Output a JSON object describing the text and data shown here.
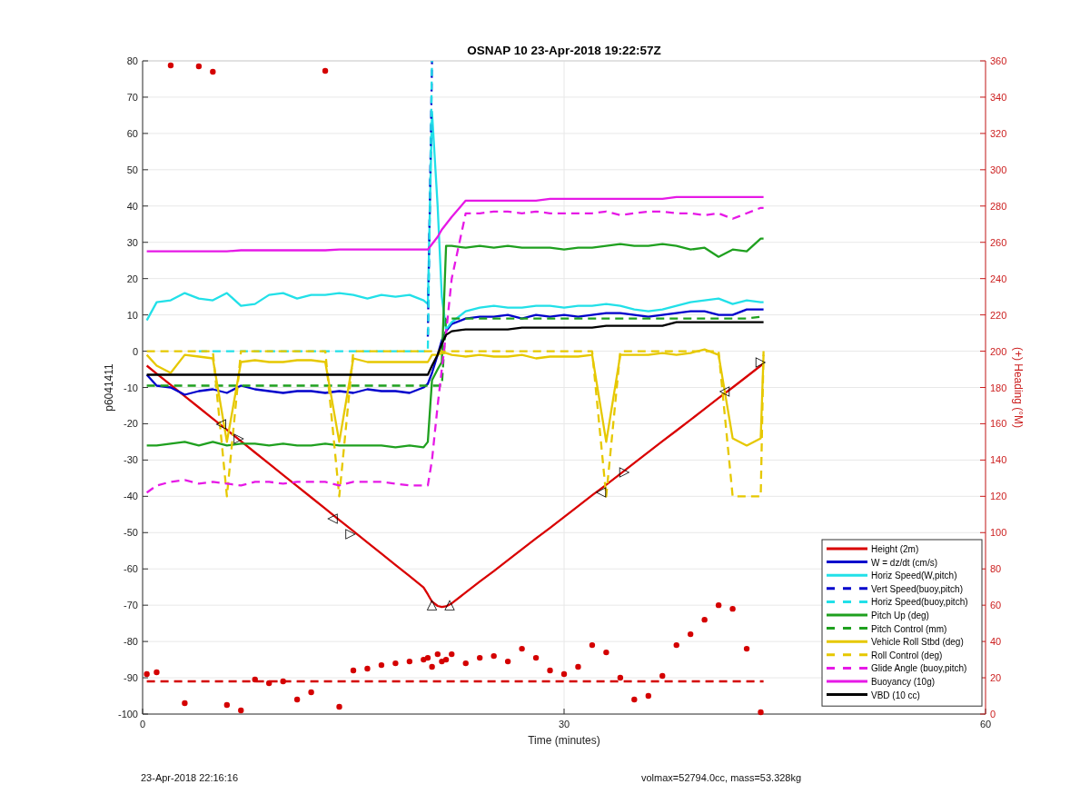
{
  "figure": {
    "chart_data": {
      "type": "line",
      "title": "OSNAP 10 23-Apr-2018 19:22:57Z",
      "xlabel": "Time (minutes)",
      "ylabel": "p6041411",
      "y2label": "(+) Heading (°M)",
      "xlim": [
        0,
        60
      ],
      "ylim": [
        -100,
        80
      ],
      "y2lim": [
        0,
        360
      ],
      "xticks": [
        0,
        30,
        60
      ],
      "yticks": [
        -100,
        -90,
        -80,
        -70,
        -60,
        -50,
        -40,
        -30,
        -20,
        -10,
        0,
        10,
        20,
        30,
        40,
        50,
        60,
        70,
        80
      ],
      "y2ticks": [
        0,
        20,
        40,
        60,
        80,
        100,
        120,
        140,
        160,
        180,
        200,
        220,
        240,
        260,
        280,
        300,
        320,
        340,
        360
      ],
      "grid": true,
      "legend": true,
      "x": [
        0.3,
        1,
        2,
        3,
        4,
        5,
        6,
        7,
        8,
        9,
        10,
        11,
        12,
        13,
        14,
        15,
        16,
        17,
        18,
        19,
        20,
        20.3,
        20.6,
        21,
        21.3,
        21.6,
        22,
        23,
        24,
        25,
        26,
        27,
        28,
        29,
        30,
        31,
        32,
        33,
        34,
        35,
        36,
        37,
        38,
        39,
        40,
        41,
        42,
        43,
        44,
        44.2
      ],
      "series": [
        {
          "name": "Height (2m)",
          "color": "#d90000",
          "line_style": "solid",
          "values": [
            -4,
            -6.2,
            -9.3,
            -12.4,
            -15.5,
            -18.6,
            -21.7,
            -24.8,
            -27.9,
            -31,
            -34.1,
            -37.2,
            -40.3,
            -43.4,
            -46.5,
            -49.6,
            -52.7,
            -55.8,
            -58.9,
            -62,
            -65.1,
            -67,
            -69,
            -70.2,
            -70.5,
            -70.3,
            -69.5,
            -66.5,
            -63.5,
            -60.6,
            -57.6,
            -54.6,
            -51.6,
            -48.7,
            -45.7,
            -42.7,
            -39.7,
            -36.8,
            -33.8,
            -30.8,
            -27.8,
            -24.8,
            -21.9,
            -18.9,
            -15.9,
            -12.9,
            -10,
            -7,
            -4,
            -3.4
          ]
        },
        {
          "name": "W = dz/dt (cm/s)",
          "color": "#0000cc",
          "line_style": "solid",
          "values": [
            -6.5,
            -9.5,
            -10,
            -12,
            -11,
            -10.5,
            -11.5,
            -9.5,
            -10.5,
            -11,
            -11.5,
            -11,
            -11,
            -11.5,
            -11,
            -11.5,
            -10.5,
            -11,
            -11,
            -11.5,
            -10,
            -9,
            -6,
            -1,
            3,
            5.5,
            7.5,
            9,
            9.5,
            9.5,
            10,
            9,
            10,
            9.5,
            10,
            9.5,
            10,
            10.5,
            10.5,
            10,
            9.5,
            10,
            10.5,
            11,
            11,
            10,
            10,
            11.5,
            11.5,
            11.5
          ]
        },
        {
          "name": "Horiz Speed(W,pitch)",
          "color": "#22e0e8",
          "line_style": "solid",
          "values": [
            8.5,
            13.5,
            14,
            16,
            14.5,
            14,
            16,
            12.5,
            13,
            15.5,
            16,
            14.5,
            15.5,
            15.5,
            16,
            15.5,
            14.5,
            15.5,
            15,
            15.5,
            14,
            13,
            66,
            40,
            15,
            6,
            8,
            11,
            12,
            12.5,
            12,
            12,
            12.5,
            12.5,
            12,
            12.5,
            12.5,
            13,
            12.5,
            11.5,
            11,
            11.5,
            12.5,
            13.5,
            14,
            14.5,
            13,
            14,
            13.5,
            13.5
          ]
        },
        {
          "name": "Vert Speed(buoy,pitch)",
          "color": "#0000cc",
          "line_style": "dashed",
          "values": [
            null,
            null,
            null,
            null,
            null,
            null,
            null,
            null,
            null,
            null,
            null,
            null,
            null,
            null,
            null,
            null,
            null,
            null,
            null,
            null,
            null,
            4,
            80,
            null,
            null,
            null,
            null,
            null,
            null,
            null,
            null,
            null,
            null,
            null,
            null,
            null,
            null,
            null,
            null,
            null,
            null,
            null,
            null,
            null,
            null,
            null,
            null,
            null,
            null,
            null
          ]
        },
        {
          "name": "Horiz Speed(buoy,pitch)",
          "color": "#22e0e8",
          "line_style": "dashed",
          "values": [
            null,
            null,
            null,
            null,
            0,
            0,
            0,
            0,
            0,
            0,
            0,
            0,
            0,
            0,
            0,
            0,
            0,
            0,
            0,
            0,
            0,
            0,
            80,
            null,
            null,
            null,
            null,
            null,
            null,
            null,
            null,
            null,
            null,
            null,
            null,
            null,
            null,
            null,
            null,
            null,
            null,
            null,
            null,
            null,
            null,
            null,
            null,
            null,
            null,
            null
          ]
        },
        {
          "name": "Pitch Up (deg)",
          "color": "#1fa01f",
          "line_style": "solid",
          "values": [
            -26,
            -26,
            -25.5,
            -25,
            -26,
            -25,
            -26,
            -25.5,
            -25.5,
            -26,
            -25.5,
            -26,
            -26,
            -25.5,
            -26,
            -26,
            -26,
            -26,
            -26.5,
            -26,
            -26.5,
            -25,
            -8,
            -5,
            -3,
            29,
            29,
            28.5,
            29,
            28.5,
            29,
            28.5,
            28.5,
            28.5,
            28,
            28.5,
            28.5,
            29,
            29.5,
            29,
            29,
            29.5,
            29,
            28,
            28.5,
            26,
            28,
            27.5,
            31,
            31
          ]
        },
        {
          "name": "Pitch Control (mm)",
          "color": "#1fa01f",
          "line_style": "dashed",
          "values": [
            -9.5,
            -9.5,
            -9.5,
            -9.5,
            -9.5,
            -9.5,
            -9.5,
            -9.5,
            -9.5,
            -9.5,
            -9.5,
            -9.5,
            -9.5,
            -9.5,
            -9.5,
            -9.5,
            -9.5,
            -9.5,
            -9.5,
            -9.5,
            -9.5,
            -9.5,
            -9.5,
            -9.5,
            -9.5,
            9,
            9,
            9,
            9,
            9,
            9,
            9,
            9,
            9,
            9,
            9,
            9,
            9,
            9,
            9,
            9,
            9,
            9,
            9,
            9,
            9,
            9,
            9,
            9.5,
            9.5
          ]
        },
        {
          "name": "Vehicle Roll Stbd (deg)",
          "color": "#e6c800",
          "line_style": "solid",
          "values": [
            -1,
            -4,
            -6,
            -1,
            -1.5,
            -2,
            -25,
            -3,
            -2.5,
            -3,
            -3,
            -2.5,
            -2.5,
            -3,
            -25,
            -2,
            -3,
            -3,
            -3,
            -3,
            -3,
            -3,
            -1,
            -1,
            -0.5,
            -0.5,
            -1,
            -1.5,
            -1,
            -1.5,
            -1.5,
            -1,
            -2,
            -1.5,
            -1.5,
            -1.5,
            -1,
            -25,
            -1,
            -1,
            -1,
            -0.5,
            -1,
            -0.5,
            0.5,
            -1,
            -24,
            -26,
            -24,
            -1
          ]
        },
        {
          "name": "Roll Control (deg)",
          "color": "#e6c800",
          "line_style": "dashed",
          "values": [
            0,
            0,
            0,
            0,
            0,
            0,
            -40,
            0,
            0,
            0,
            0,
            0,
            0,
            0,
            -40,
            0,
            0,
            0,
            0,
            0,
            0,
            0,
            0,
            0,
            0,
            0,
            0,
            0,
            0,
            0,
            0,
            0,
            0,
            0,
            0,
            0,
            0,
            -40,
            0,
            0,
            0,
            0,
            0,
            0,
            0,
            0,
            -40,
            -40,
            -40,
            0
          ]
        },
        {
          "name": "Glide Angle (buoy,pitch)",
          "color": "#e619e6",
          "line_style": "dashed",
          "values": [
            -39,
            -37,
            -36,
            -35.5,
            -36.5,
            -36,
            -36.5,
            -37,
            -36,
            -36,
            -36.5,
            -36,
            -36,
            -36,
            -37,
            -36,
            -36,
            -36,
            -36.5,
            -37,
            -37,
            -37,
            -30,
            -15,
            -5,
            5,
            20,
            38,
            38,
            38.5,
            38.5,
            38,
            38.5,
            38,
            38,
            38,
            38,
            38.5,
            37.5,
            38,
            38.5,
            38.5,
            38,
            38,
            37.5,
            38,
            36.5,
            38,
            39.5,
            39.5
          ]
        },
        {
          "name": "Buoyancy (10g)",
          "color": "#e619e6",
          "line_style": "solid",
          "values": [
            27.5,
            27.5,
            27.5,
            27.5,
            27.5,
            27.5,
            27.5,
            27.8,
            27.8,
            27.8,
            27.8,
            27.8,
            27.8,
            27.8,
            28,
            28,
            28,
            28,
            28,
            28,
            28,
            28,
            29.5,
            31.5,
            33.5,
            35,
            37,
            41.5,
            41.5,
            41.5,
            41.5,
            41.5,
            41.5,
            42,
            42,
            42,
            42,
            42,
            42,
            42,
            42,
            42,
            42.5,
            42.5,
            42.5,
            42.5,
            42.5,
            42.5,
            42.5,
            42.5
          ]
        },
        {
          "name": "VBD (10 cc)",
          "color": "#000000",
          "line_style": "solid",
          "values": [
            -6.5,
            -6.5,
            -6.5,
            -6.5,
            -6.5,
            -6.5,
            -6.5,
            -6.5,
            -6.5,
            -6.5,
            -6.5,
            -6.5,
            -6.5,
            -6.5,
            -6.5,
            -6.5,
            -6.5,
            -6.5,
            -6.5,
            -6.5,
            -6.5,
            -6.5,
            -4,
            -1,
            2,
            4.5,
            5.5,
            6,
            6,
            6,
            6,
            6.5,
            6.5,
            6.5,
            6.5,
            6.5,
            6.5,
            7,
            7,
            7,
            7,
            7,
            8,
            8,
            8,
            8,
            8,
            8,
            8,
            8
          ]
        },
        {
          "type": "scatter",
          "marker": "circle",
          "line_style": "none",
          "color": "#d40000",
          "axis": "y2",
          "values": [
            22,
            23,
            357.5,
            6,
            357,
            354,
            5,
            2,
            19,
            17,
            18,
            8,
            12,
            354.5,
            4,
            24,
            25,
            27,
            28,
            29,
            30,
            31,
            26,
            33,
            29,
            30,
            33,
            28,
            31,
            32,
            29,
            36,
            31,
            24,
            22,
            26,
            38,
            34,
            20,
            8,
            10,
            21,
            38,
            44,
            52,
            60,
            58,
            36,
            1,
            null
          ]
        },
        {
          "color": "#d40000",
          "line_style": "dashed",
          "axis": "y2",
          "values": [
            18,
            18,
            18,
            18,
            18,
            18,
            18,
            18,
            18,
            18,
            18,
            18,
            18,
            18,
            18,
            18,
            18,
            18,
            18,
            18,
            18,
            18,
            18,
            18,
            18,
            18,
            18,
            18,
            18,
            18,
            18,
            18,
            18,
            18,
            18,
            18,
            18,
            18,
            18,
            18,
            18,
            18,
            18,
            18,
            18,
            18,
            18,
            18,
            18,
            18
          ]
        }
      ],
      "annotations": [
        {
          "x": 5.56,
          "y": -20,
          "text": "◁"
        },
        {
          "x": 6.85,
          "y": -24,
          "text": "▷"
        },
        {
          "x": 13.5,
          "y": -46,
          "text": "◁"
        },
        {
          "x": 14.8,
          "y": -50.2,
          "text": "▷"
        },
        {
          "x": 20.6,
          "y": -69.7,
          "text": "△"
        },
        {
          "x": 21.85,
          "y": -69.7,
          "text": "△"
        },
        {
          "x": 32.6,
          "y": -38.7,
          "text": "◁"
        },
        {
          "x": 34.3,
          "y": -33.2,
          "text": "▷"
        },
        {
          "x": 41.4,
          "y": -10.9,
          "text": "◁"
        },
        {
          "x": 44,
          "y": -2.9,
          "text": "▷"
        }
      ]
    }
  },
  "footer": {
    "timestamp": "23-Apr-2018 22:16:16",
    "summary": "volmax=52794.0cc, mass=53.328kg"
  }
}
